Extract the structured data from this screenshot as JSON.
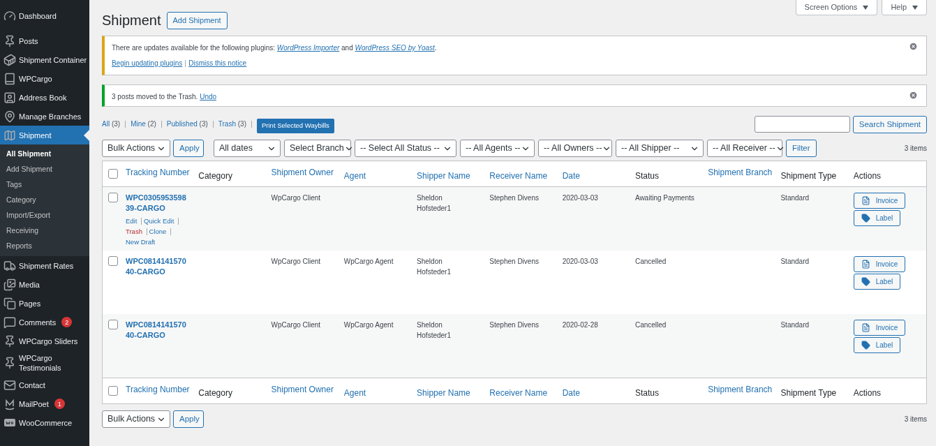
{
  "sidebar": {
    "items": [
      {
        "label": "Dashboard",
        "selected": false
      },
      {
        "label": "Posts",
        "selected": false
      },
      {
        "label": "Shipment Container",
        "selected": false
      },
      {
        "label": "WPCargo",
        "selected": false
      },
      {
        "label": "Address Book",
        "selected": false
      },
      {
        "label": "Manage Branches",
        "selected": false
      },
      {
        "label": "Shipment",
        "selected": true,
        "children": [
          {
            "label": "All Shipment",
            "selected": true
          },
          {
            "label": "Add Shipment",
            "selected": false
          },
          {
            "label": "Tags",
            "selected": false
          },
          {
            "label": "Category",
            "selected": false
          },
          {
            "label": "Import/Export",
            "selected": false
          },
          {
            "label": "Receiving",
            "selected": false
          },
          {
            "label": "Reports",
            "selected": false
          }
        ]
      },
      {
        "label": "Shipment Rates",
        "selected": false
      },
      {
        "label": "Media",
        "selected": false
      },
      {
        "label": "Pages",
        "selected": false
      },
      {
        "label": "Comments",
        "selected": false,
        "badge": "2"
      },
      {
        "label": "WPCargo Sliders",
        "selected": false
      },
      {
        "label": "WPCargo Testimonials",
        "selected": false
      },
      {
        "label": "Contact",
        "selected": false
      },
      {
        "label": "MailPoet",
        "selected": false,
        "badge": "1"
      },
      {
        "label": "WooCommerce",
        "selected": false
      }
    ]
  },
  "top_tabs": [
    "Screen Options",
    "Help"
  ],
  "page_title": "Shipment",
  "add_button": "Add Shipment",
  "notices": [
    {
      "kind": "warning",
      "parts": [
        {
          "kind": "text",
          "text": "There are updates available for the following plugins: "
        },
        {
          "kind": "link",
          "text": "WordPress Importer"
        },
        {
          "kind": "text",
          "text": " and "
        },
        {
          "kind": "link",
          "text": "WordPress SEO by Yoast"
        },
        {
          "kind": "text",
          "text": "."
        }
      ],
      "actions": [
        "Begin updating plugins",
        "Dismiss this notice"
      ]
    },
    {
      "kind": "success",
      "parts": [
        {
          "kind": "text",
          "text": "3 posts moved to the Trash. "
        },
        {
          "kind": "link",
          "text": "Undo"
        }
      ]
    }
  ],
  "views": [
    {
      "label": "All",
      "count": "(3)"
    },
    {
      "label": "Mine",
      "count": "(2)"
    },
    {
      "label": "Published",
      "count": "(3)"
    },
    {
      "label": "Trash",
      "count": "(3)"
    }
  ],
  "print_button": "Print Selected Waybills",
  "search": {
    "button": "Search Shipment"
  },
  "top_filters": {
    "bulk": "Bulk Actions",
    "apply": "Apply",
    "selects": [
      "All dates",
      "Select Branch",
      "-- Select All Status --",
      "-- All Agents --",
      "-- All Owners --",
      "-- All Shipper --",
      "-- All Receiver --"
    ],
    "filter": "Filter",
    "count": "3 items"
  },
  "header_checkbox_checked": false,
  "footer_checkbox_checked": false,
  "columns": [
    {
      "label": "Tracking Number",
      "sortable": true
    },
    {
      "label": "Category",
      "sortable": false
    },
    {
      "label": "Shipment Owner",
      "sortable": true
    },
    {
      "label": "Agent",
      "sortable": true
    },
    {
      "label": "Shipper Name",
      "sortable": true
    },
    {
      "label": "Receiver Name",
      "sortable": true
    },
    {
      "label": "Date",
      "sortable": true
    },
    {
      "label": "Status",
      "sortable": false
    },
    {
      "label": "Shipment Branch",
      "sortable": true
    },
    {
      "label": "Shipment Type",
      "sortable": false
    },
    {
      "label": "Actions",
      "sortable": false
    }
  ],
  "rows": [
    {
      "checked": false,
      "tracking": "WPC030595359839-CARGO",
      "row_actions": [
        {
          "kind": "link",
          "text": "Edit"
        },
        {
          "kind": "link",
          "text": "Quick Edit"
        },
        {
          "kind": "danger",
          "text": "Trash"
        },
        {
          "kind": "link",
          "text": "Clone"
        },
        {
          "kind": "link",
          "text": "New Draft"
        }
      ],
      "owner": "WpCargo Client",
      "shipper": "Sheldon Hofsteder1",
      "receiver": "Stephen Divens",
      "date": "2020-03-03",
      "status": "Awaiting Payments",
      "type": "Standard",
      "buttons": [
        "Invoice",
        "Label"
      ]
    },
    {
      "checked": false,
      "tracking": "WPC081414157040-CARGO",
      "owner": "WpCargo Client",
      "agent": "WpCargo Agent",
      "shipper": "Sheldon Hofsteder1",
      "receiver": "Stephen Divens",
      "date": "2020-03-03",
      "status": "Cancelled",
      "type": "Standard",
      "buttons": [
        "Invoice",
        "Label"
      ]
    },
    {
      "checked": false,
      "tracking": "WPC081414157040-CARGO",
      "owner": "WpCargo Client",
      "agent": "WpCargo Agent",
      "shipper": "Sheldon Hofsteder1",
      "receiver": "Stephen Divens",
      "date": "2020-02-28",
      "status": "Cancelled",
      "type": "Standard",
      "buttons": [
        "Invoice",
        "Label"
      ]
    }
  ],
  "footer_columns": [
    {
      "label": "Tracking Number",
      "sortable": true
    },
    {
      "label": "Category",
      "sortable": false
    },
    {
      "label": "Shipment Owner",
      "sortable": true
    },
    {
      "label": "Agent",
      "sortable": true
    },
    {
      "label": "Shipper Name",
      "sortable": true
    },
    {
      "label": "Receiver Name",
      "sortable": true
    },
    {
      "label": "Date",
      "sortable": true
    },
    {
      "label": "Status",
      "sortable": false
    },
    {
      "label": "Shipment Branch",
      "sortable": true
    },
    {
      "label": "Shipment Type",
      "sortable": false
    },
    {
      "label": "Actions",
      "sortable": false
    }
  ],
  "bottom_filters": {
    "bulk": "Bulk Actions",
    "apply": "Apply",
    "count": "3 items"
  }
}
